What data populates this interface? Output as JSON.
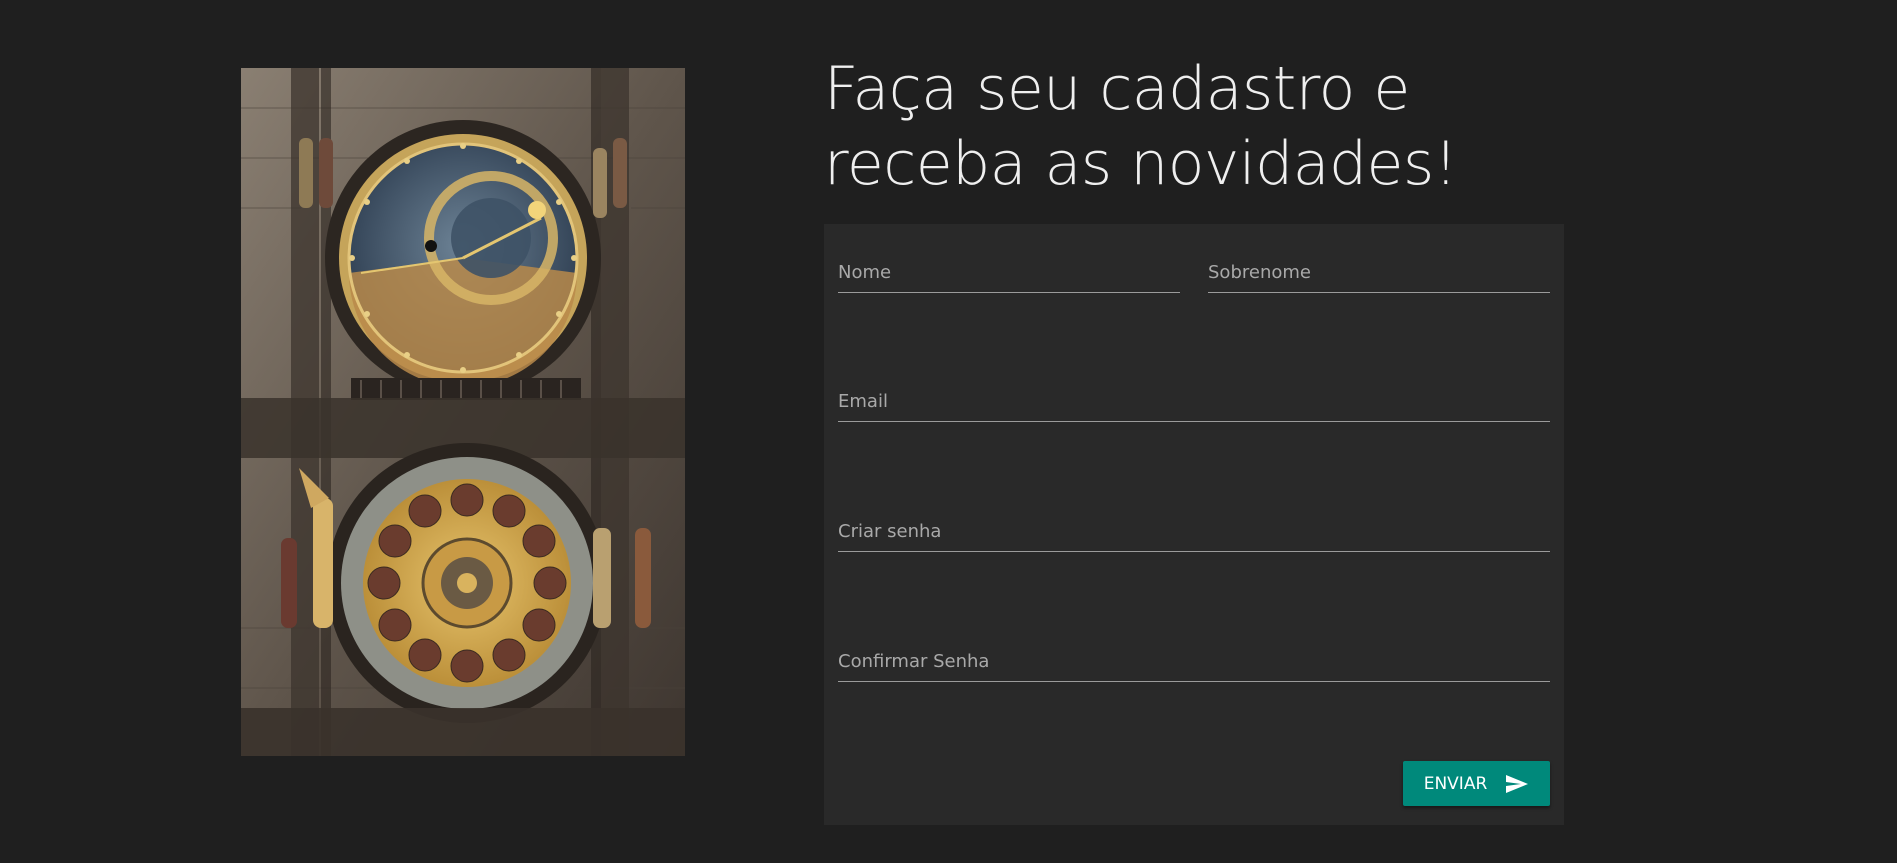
{
  "heading": {
    "line1": "Faça seu cadastro e",
    "line2": "receba as novidades!"
  },
  "image": {
    "subject": "astronomical-clock",
    "alt": ""
  },
  "form": {
    "fields": {
      "nome": {
        "placeholder": "Nome",
        "value": ""
      },
      "sobrenome": {
        "placeholder": "Sobrenome",
        "value": ""
      },
      "email": {
        "placeholder": "Email",
        "value": ""
      },
      "senha": {
        "placeholder": "Criar senha",
        "value": ""
      },
      "confirmar": {
        "placeholder": "Confirmar Senha",
        "value": ""
      }
    },
    "submit": {
      "label": "ENVIAR",
      "icon": "send-icon"
    }
  },
  "colors": {
    "page_background": "#1f1f1f",
    "card_background": "#292929",
    "accent": "#00897b",
    "text": "#efefef",
    "placeholder": "#a9a9a9"
  }
}
